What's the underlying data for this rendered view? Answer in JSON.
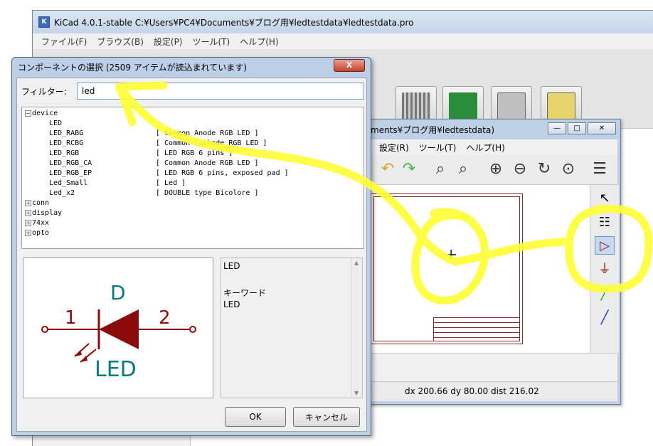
{
  "main_window": {
    "title": "KiCad 4.0.1-stable C:¥Users¥PC4¥Documents¥ブログ用¥ledtestdata¥ledtestdata.pro",
    "menu": [
      "ファイル(F)",
      "ブラウズ(B)",
      "設定(P)",
      "ツール(T)",
      "ヘルプ(H)"
    ]
  },
  "schematic_window": {
    "title": "ments¥ブログ用¥ledtestdata)",
    "menu": [
      "設定(R)",
      "ツール(T)",
      "ヘルプ(H)"
    ],
    "status": "dx 200.66  dy 80.00  dist 216.02"
  },
  "dialog": {
    "title": "コンポーネントの選択 (2509 アイテムが読込まれています)",
    "close_label": "X",
    "filter_label": "フィルター:",
    "filter_value": "led",
    "tree": {
      "device": {
        "label": "device",
        "items": [
          {
            "name": "LED",
            "desc": ""
          },
          {
            "name": "LED_RABG",
            "desc": "[ Common Anode RGB LED ]"
          },
          {
            "name": "LED_RCBG",
            "desc": "[ Common Cathode RGB LED ]"
          },
          {
            "name": "LED_RGB",
            "desc": "[ LED RGB 6 pins ]"
          },
          {
            "name": "LED_RGB_CA",
            "desc": "[ Common Anode RGB LED ]"
          },
          {
            "name": "LED_RGB_EP",
            "desc": "[ LED RGB 6 pins, exposed pad ]"
          },
          {
            "name": "Led_Small",
            "desc": "[ Led ]"
          },
          {
            "name": "Led_x2",
            "desc": "[ DOUBLE type Bicolore ]"
          }
        ]
      },
      "collapsed": [
        "conn",
        "display",
        "74xx",
        "opto"
      ]
    },
    "preview": {
      "reference": "D",
      "value": "LED",
      "pin1": "1",
      "pin2": "2"
    },
    "info": {
      "name": "LED",
      "keyword_label": "キーワード",
      "keyword": "LED"
    },
    "ok_label": "OK",
    "cancel_label": "キャンセル"
  },
  "colors": {
    "symbol": "#8b0a0a",
    "symbol_text": "#0a7b7b",
    "scribble": "#ffff33"
  }
}
